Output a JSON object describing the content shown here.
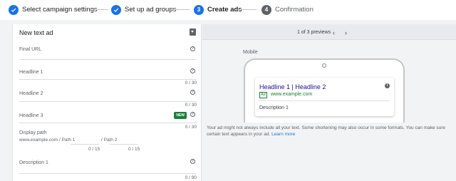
{
  "stepper": {
    "steps": [
      {
        "label": "Select campaign settings",
        "state": "done",
        "marker": "check-icon"
      },
      {
        "label": "Set up ad groups",
        "state": "done",
        "marker": "check-icon"
      },
      {
        "label": "Create ads",
        "state": "active",
        "number": "3"
      },
      {
        "label": "Confirmation",
        "state": "todo",
        "number": "4"
      }
    ]
  },
  "form": {
    "title": "New text ad",
    "fields": {
      "final_url": {
        "label": "Final URL"
      },
      "headline1": {
        "label": "Headline 1",
        "count": "0 / 30"
      },
      "headline2": {
        "label": "Headline 2",
        "count": "0 / 30"
      },
      "headline3": {
        "label": "Headline 3",
        "badge": "NEW",
        "count": "0 / 30"
      },
      "display_path": {
        "label": "Display path",
        "domain": "www.example.com / Path 1",
        "sep": "/ Path 2",
        "count1": "0 / 15",
        "count2": "0 / 15"
      },
      "description1": {
        "label": "Description 1",
        "count": "0 / 90"
      }
    }
  },
  "preview": {
    "count": "1 of 3 previews",
    "prev": "‹",
    "next": "›",
    "device": "Mobile",
    "ad": {
      "headline": "Headline 1 | Headline 2",
      "badge": "Ad",
      "url": "www.example.com",
      "description": "Description 1"
    },
    "disclaimer": "Your ad might not always include all your text. Some shortening may also occur in some formats. You can make sure certain text appears in your ad.",
    "learn_more": "Learn more"
  },
  "colors": {
    "accent": "#1a73e8",
    "green": "#188038",
    "headline_link": "#1a0dab"
  }
}
